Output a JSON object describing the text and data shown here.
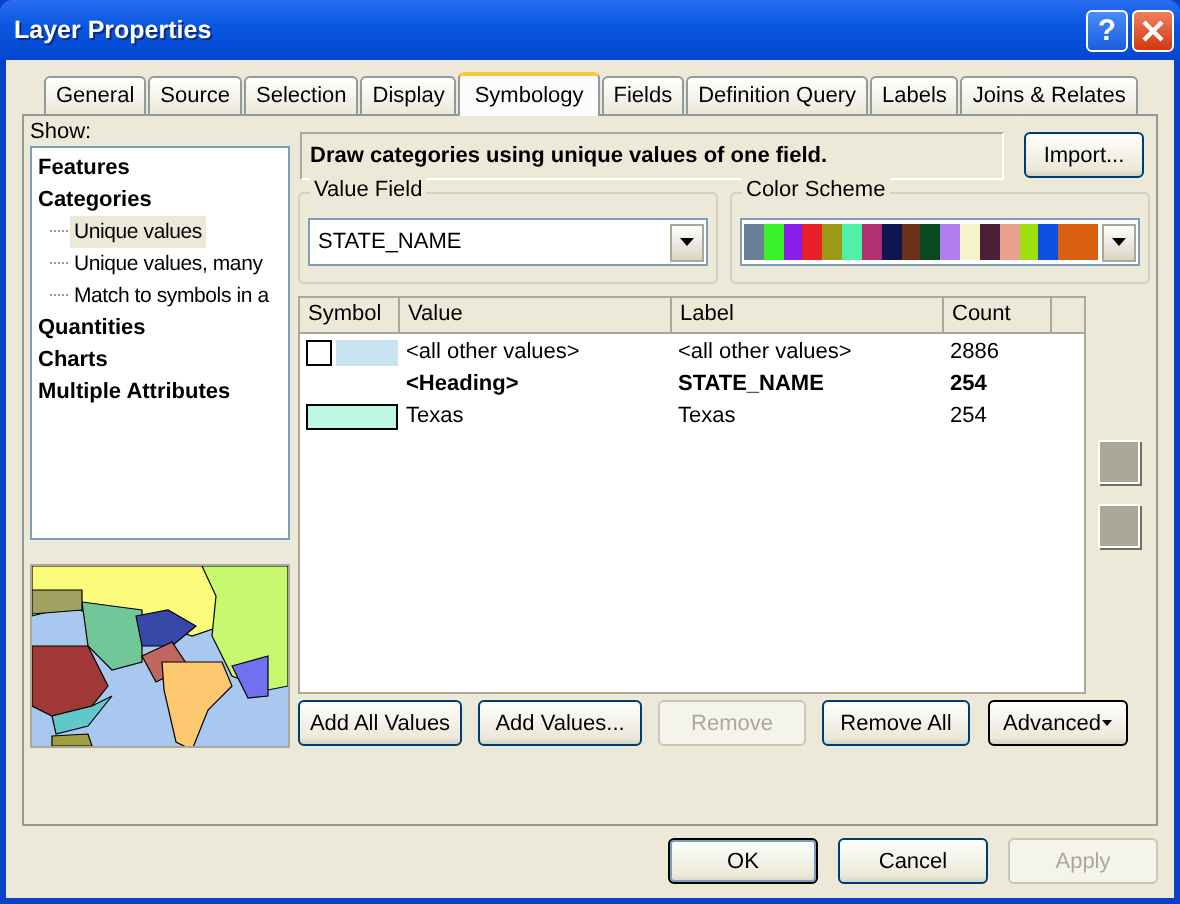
{
  "window": {
    "title": "Layer Properties",
    "help_button": "?"
  },
  "tabs": [
    {
      "label": "General",
      "selected": false
    },
    {
      "label": "Source",
      "selected": false
    },
    {
      "label": "Selection",
      "selected": false
    },
    {
      "label": "Display",
      "selected": false
    },
    {
      "label": "Symbology",
      "selected": true
    },
    {
      "label": "Fields",
      "selected": false
    },
    {
      "label": "Definition Query",
      "selected": false
    },
    {
      "label": "Labels",
      "selected": false
    },
    {
      "label": "Joins & Relates",
      "selected": false
    }
  ],
  "show_label": "Show:",
  "tree": [
    {
      "label": "Features",
      "selected": false
    },
    {
      "label": "Categories",
      "selected": false,
      "children": [
        {
          "label": "Unique values",
          "selected": true
        },
        {
          "label": "Unique values, many",
          "selected": false
        },
        {
          "label": "Match to symbols in a",
          "selected": false
        }
      ]
    },
    {
      "label": "Quantities",
      "selected": false
    },
    {
      "label": "Charts",
      "selected": false
    },
    {
      "label": "Multiple Attributes",
      "selected": false
    }
  ],
  "description": "Draw categories using unique values of one field.",
  "import_button": {
    "label": "Import...",
    "disabled": false
  },
  "value_field": {
    "legend": "Value Field",
    "value": "STATE_NAME"
  },
  "color_scheme": {
    "legend": "Color Scheme",
    "colors": [
      {
        "color": "#6a7f96"
      },
      {
        "color": "#3af12a"
      },
      {
        "color": "#8a1ee8"
      },
      {
        "color": "#e8202a"
      },
      {
        "color": "#9a9a18"
      },
      {
        "color": "#50f0a8"
      },
      {
        "color": "#b03070"
      },
      {
        "color": "#101450"
      },
      {
        "color": "#6a3018"
      },
      {
        "color": "#0a4a20"
      },
      {
        "color": "#b080f0"
      },
      {
        "color": "#f4f4c8"
      },
      {
        "color": "#4a2038"
      },
      {
        "color": "#e8a090"
      },
      {
        "color": "#a0e010"
      },
      {
        "color": "#1050e0"
      },
      {
        "color": "#d86010"
      },
      {
        "color": "#d86010"
      }
    ]
  },
  "table": {
    "columns": [
      "Symbol",
      "Value",
      "Label",
      "Count"
    ],
    "rows": [
      {
        "kind": "other",
        "symbol": [
          {
            "color": "#ffffff"
          },
          {
            "color": "#c8e2f0"
          }
        ],
        "value": "<all other values>",
        "label": "<all other values>",
        "count": "2886"
      },
      {
        "kind": "heading",
        "value": "<Heading>",
        "label": "STATE_NAME",
        "count": "254"
      },
      {
        "kind": "value",
        "symbol": [
          {
            "color": "#bcf8e4"
          }
        ],
        "value": "Texas",
        "label": "Texas",
        "count": "254"
      }
    ]
  },
  "action_buttons": [
    {
      "label": "Add All Values",
      "kind": "plain",
      "disabled": false
    },
    {
      "label": "Add Values...",
      "kind": "plain",
      "disabled": false
    },
    {
      "label": "Remove",
      "kind": "plain",
      "disabled": true
    },
    {
      "label": "Remove All",
      "kind": "plain",
      "disabled": false
    },
    {
      "label": "Advanced",
      "kind": "menu",
      "disabled": false
    }
  ],
  "dialog_buttons": [
    {
      "label": "OK",
      "default": true,
      "disabled": false
    },
    {
      "label": "Cancel",
      "default": false,
      "disabled": false
    },
    {
      "label": "Apply",
      "default": false,
      "disabled": true
    }
  ]
}
